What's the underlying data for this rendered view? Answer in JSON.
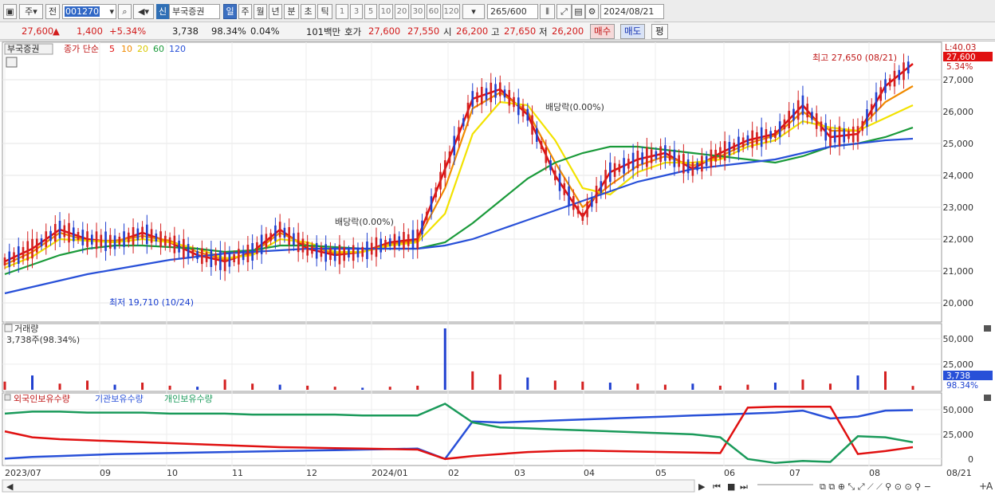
{
  "toolbar": {
    "market_type": "주",
    "market_prev": "전",
    "stock_code": "001270",
    "stock_badge": "신",
    "stock_name": "부국증권",
    "periods": [
      "일",
      "주",
      "월",
      "년",
      "분",
      "초",
      "틱"
    ],
    "active_period": "일",
    "minute_steps": [
      "1",
      "3",
      "5",
      "10",
      "20",
      "30",
      "60",
      "120"
    ],
    "count_shown": "265",
    "count_total": "/600",
    "date": "2024/08/21"
  },
  "quote": {
    "price": "27,600",
    "change": "1,400",
    "change_pct": "+5.34%",
    "volume": "3,738",
    "volume_ratio": "98.34%",
    "turnover": "0.04%",
    "amount_unit": "101백만",
    "bid_label": "호가",
    "bid1": "27,600",
    "bid2": "27,550",
    "open_label": "시",
    "open": "26,200",
    "high_label": "고",
    "high": "27,650",
    "low_label": "저",
    "low": "26,200",
    "buy_label": "매수",
    "sell_label": "매도",
    "eval_label": "평"
  },
  "price_panel": {
    "legend_name": "부국증권",
    "ma_label": "종가 단순",
    "ma_periods": [
      "5",
      "10",
      "20",
      "60",
      "120"
    ],
    "ma_colors": [
      "#e01010",
      "#f08a00",
      "#f2e200",
      "#1a9a3a",
      "#2850d8"
    ],
    "y_ticks": [
      "27,000",
      "26,000",
      "25,000",
      "24,000",
      "23,000",
      "22,000",
      "21,000",
      "20,000"
    ],
    "last_price_tag": "27,600",
    "last_pct_tag": "5.34%",
    "axis_top_label": "L:40.03",
    "high_annotation": "최고 27,650 (08/21)",
    "low_annotation": "최저 19,710 (10/24)",
    "dividend_note_1": "배당락(0.00%)",
    "dividend_note_2": "배당락(0.00%)"
  },
  "volume_panel": {
    "title": "거래량",
    "value_label": "3,738주(98.34%)",
    "y_ticks": [
      "50,000",
      "25,000"
    ],
    "last_tag": "3,738",
    "last_pct": "98.34%"
  },
  "holding_panel": {
    "legend": [
      "외국인보유수량",
      "기관보유수량",
      "개인보유수량"
    ],
    "colors": [
      "#2850d8",
      "#e01010",
      "#1a9a5a"
    ],
    "y_ticks": [
      "50,000",
      "25,000",
      "0"
    ]
  },
  "x_axis": {
    "labels": [
      "2023/07",
      "09",
      "10",
      "11",
      "12",
      "2024/01",
      "02",
      "03",
      "04",
      "05",
      "06",
      "07",
      "08"
    ],
    "last_date": "08/21"
  },
  "chart_data": [
    {
      "type": "line",
      "title": "",
      "series": [
        {
          "name": "5",
          "values": [
            21300,
            21700,
            22300,
            22000,
            21900,
            22200,
            21900,
            21500,
            21300,
            21600,
            22300,
            21700,
            21500,
            21600,
            21900,
            22000,
            24200,
            26400,
            26700,
            25900,
            24000,
            22700,
            24100,
            24500,
            24700,
            24200,
            24700,
            25100,
            25300,
            26200,
            25200,
            25300,
            26800,
            27500
          ]
        },
        {
          "name": "10",
          "values": [
            21200,
            21600,
            22200,
            21950,
            21950,
            22100,
            21950,
            21600,
            21350,
            21550,
            22200,
            21800,
            21550,
            21600,
            21850,
            21950,
            23600,
            26100,
            26600,
            26000,
            24400,
            23000,
            23700,
            24300,
            24600,
            24300,
            24600,
            25000,
            25250,
            26000,
            25400,
            25400,
            26300,
            26800
          ]
        },
        {
          "name": "20",
          "values": [
            21100,
            21450,
            22000,
            21950,
            21900,
            22000,
            21900,
            21700,
            21400,
            21500,
            22000,
            21900,
            21600,
            21600,
            21800,
            21900,
            22800,
            25300,
            26300,
            26200,
            25100,
            23600,
            23400,
            24100,
            24400,
            24400,
            24500,
            24900,
            25100,
            25700,
            25500,
            25400,
            25800,
            26200
          ]
        },
        {
          "name": "60",
          "values": [
            20900,
            21200,
            21500,
            21700,
            21800,
            21800,
            21750,
            21700,
            21600,
            21650,
            21800,
            21800,
            21750,
            21700,
            21700,
            21700,
            21900,
            22500,
            23200,
            23900,
            24400,
            24700,
            24900,
            24900,
            24800,
            24700,
            24600,
            24500,
            24400,
            24600,
            24900,
            25000,
            25200,
            25500
          ]
        },
        {
          "name": "120",
          "values": [
            20300,
            20500,
            20700,
            20900,
            21050,
            21200,
            21350,
            21450,
            21550,
            21600,
            21650,
            21700,
            21700,
            21700,
            21700,
            21700,
            21800,
            22000,
            22300,
            22600,
            22900,
            23200,
            23500,
            23800,
            24000,
            24200,
            24300,
            24400,
            24500,
            24700,
            24900,
            25000,
            25100,
            25150
          ]
        }
      ],
      "ylim": [
        19500,
        27900
      ]
    },
    {
      "type": "bar",
      "title": "거래량",
      "values": [
        8000,
        14000,
        6000,
        9000,
        5000,
        7000,
        4000,
        3000,
        10000,
        6000,
        5000,
        4000,
        3000,
        2000,
        3000,
        4000,
        60000,
        18000,
        15000,
        12000,
        9000,
        8000,
        7000,
        6000,
        5000,
        6000,
        4000,
        5000,
        7000,
        10000,
        6000,
        14000,
        18000,
        3738
      ],
      "ylim": [
        0,
        60000
      ]
    },
    {
      "type": "line",
      "series": [
        {
          "name": "외국인보유수량",
          "values": [
            300,
            2000,
            3000,
            4000,
            5000,
            5500,
            6000,
            6500,
            7000,
            7500,
            8000,
            8500,
            9000,
            9500,
            10000,
            10500,
            0,
            38000,
            37000,
            38000,
            39000,
            40000,
            41000,
            42000,
            43000,
            44000,
            45000,
            46000,
            47000,
            49000,
            41000,
            43000,
            49000,
            49500
          ]
        },
        {
          "name": "기관보유수량",
          "values": [
            28000,
            22000,
            20000,
            19000,
            18000,
            17000,
            16000,
            15000,
            14000,
            13000,
            12000,
            11500,
            11000,
            10500,
            10000,
            9500,
            0,
            3000,
            5000,
            7000,
            8000,
            8500,
            8000,
            7500,
            7000,
            6500,
            6000,
            52000,
            53000,
            53000,
            53000,
            5000,
            8000,
            12000
          ]
        },
        {
          "name": "개인보유수량",
          "values": [
            46000,
            48000,
            48000,
            47000,
            47000,
            47000,
            46000,
            46000,
            46000,
            45000,
            45000,
            45000,
            45000,
            44000,
            44000,
            44000,
            56000,
            37000,
            32000,
            31000,
            30000,
            29000,
            28000,
            27000,
            26000,
            25000,
            22000,
            0,
            -4000,
            -2000,
            -3000,
            23000,
            22000,
            17000
          ]
        }
      ],
      "ylim": [
        -5000,
        58000
      ]
    }
  ]
}
